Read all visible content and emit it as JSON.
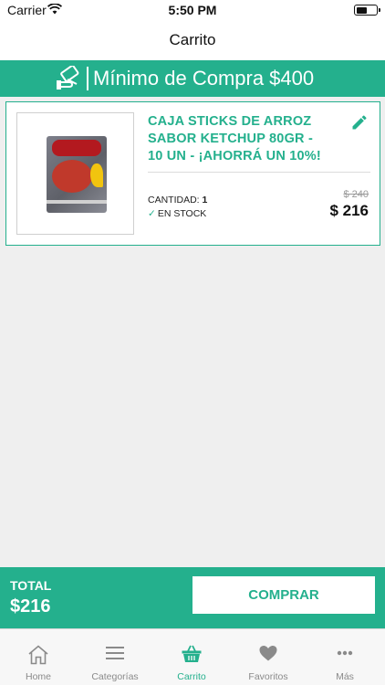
{
  "status_bar": {
    "carrier": "Carrier",
    "time": "5:50 PM",
    "battery_level": 0.55
  },
  "nav": {
    "title": "Carrito"
  },
  "banner": {
    "text": "Mínimo de Compra $400",
    "icon": "hand-card-icon"
  },
  "cart": {
    "items": [
      {
        "title": "CAJA STICKS DE ARROZ SABOR KETCHUP 80GR - 10 UN - ¡AHORRÁ UN 10%!",
        "quantity_label": "CANTIDAD:",
        "quantity": "1",
        "stock": "EN STOCK",
        "price_old": "$ 240",
        "price": "$ 216"
      }
    ]
  },
  "checkout": {
    "total_label": "TOTAL",
    "total_value": "$216",
    "buy_label": "COMPRAR"
  },
  "tabs": [
    {
      "label": "Home",
      "icon": "home-icon"
    },
    {
      "label": "Categorías",
      "icon": "menu-icon"
    },
    {
      "label": "Carrito",
      "icon": "basket-icon",
      "active": true
    },
    {
      "label": "Favoritos",
      "icon": "heart-icon"
    },
    {
      "label": "Más",
      "icon": "more-icon"
    }
  ],
  "colors": {
    "accent": "#24b08d",
    "background": "#efefef"
  }
}
